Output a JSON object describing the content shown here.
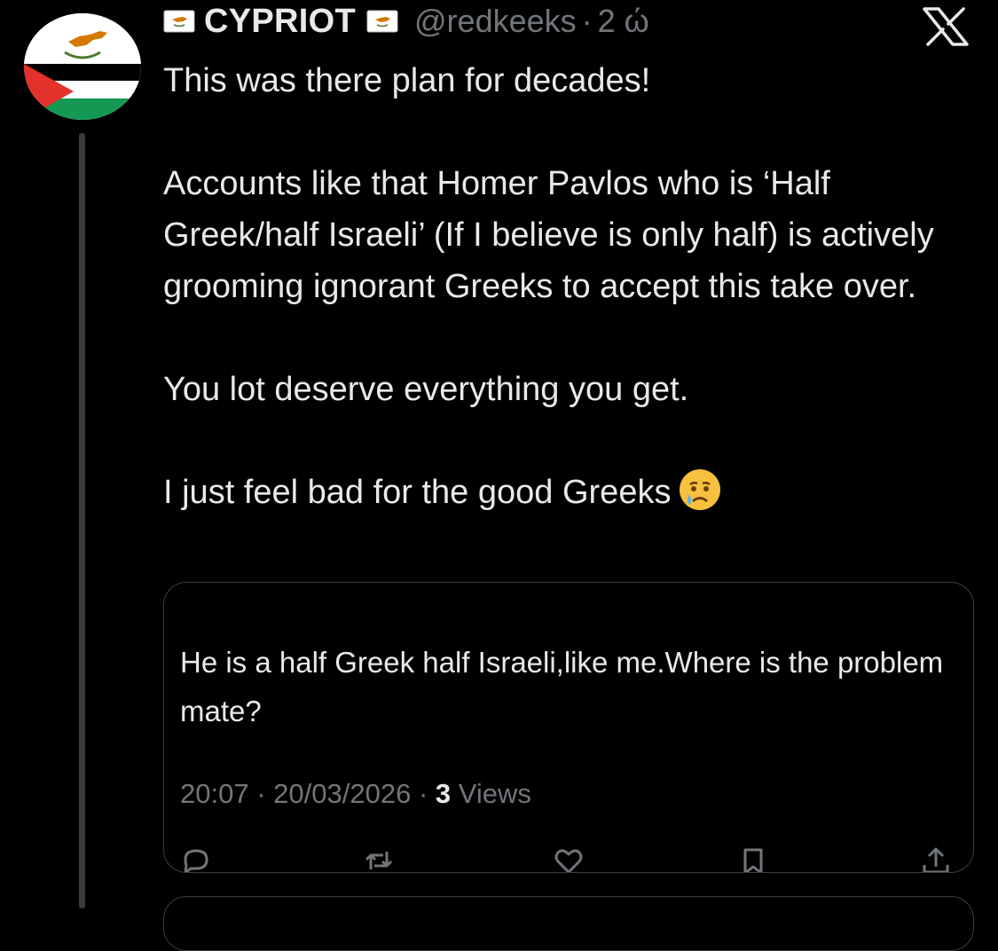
{
  "author": {
    "display_name": "CYPRIOT",
    "handle": "@redkeeks",
    "separator": "·",
    "time": "2 ώ",
    "avatar_icon": "cyprus-palestine-flag-avatar",
    "name_icons": [
      "cyprus-flag-icon",
      "cyprus-flag-icon"
    ]
  },
  "tweet": {
    "paragraphs": [
      "This was there plan for decades!",
      "Accounts like that Homer Pavlos who is ‘Half Greek/half Israeli’ (If I believe is only half) is actively grooming ignorant Greeks to accept this take over.",
      "You lot deserve everything you get.",
      "I just feel bad for the good Greeks"
    ],
    "trailing_emoji": "crying-face-emoji"
  },
  "quote": {
    "text": "He is a half Greek half Israeli,like me.Where is the problem mate?",
    "time": "20:07",
    "date": "20/03/2026",
    "separator": "·",
    "views_count": "3",
    "views_label": "Views"
  },
  "actions": [
    "reply-icon",
    "retweet-icon",
    "like-icon",
    "bookmark-icon",
    "share-icon"
  ],
  "colors": {
    "background": "#000000",
    "text": "#e7e9ea",
    "muted": "#71767b",
    "border": "#3a3d40"
  }
}
